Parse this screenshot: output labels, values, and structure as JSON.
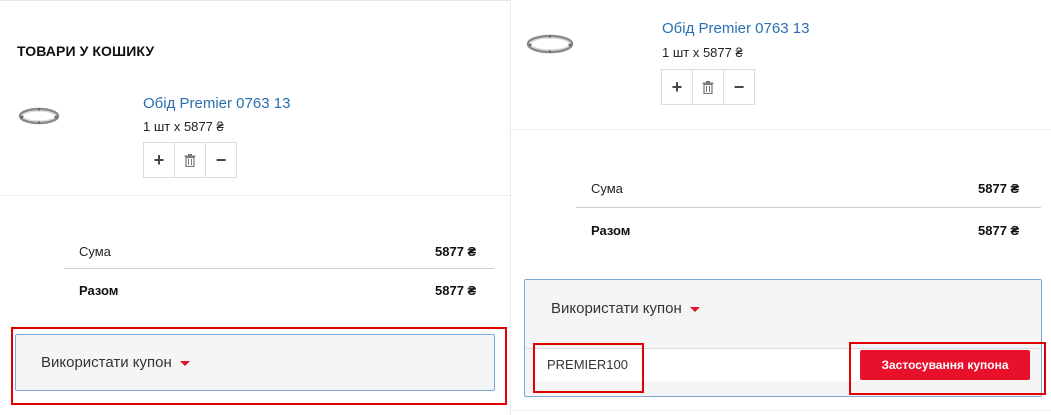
{
  "left": {
    "title": "ТОВАРИ У КОШИКУ",
    "product": {
      "name": "Обід Premier 0763 13",
      "qty_text": "1 шт x 5877 ₴"
    },
    "summary": {
      "sum_label": "Сума",
      "sum_value": "5877 ₴",
      "total_label": "Разом",
      "total_value": "5877 ₴"
    },
    "coupon": {
      "label": "Використати купон"
    }
  },
  "right": {
    "product": {
      "name": "Обід Premier 0763 13",
      "qty_text": "1 шт x 5877 ₴"
    },
    "summary": {
      "sum_label": "Сума",
      "sum_value": "5877 ₴",
      "total_label": "Разом",
      "total_value": "5877 ₴"
    },
    "coupon": {
      "label": "Використати купон",
      "input_value": "PREMIER100",
      "apply_label": "Застосування купона"
    }
  },
  "stepper": {
    "plus": "+",
    "delete_icon": "trash-icon",
    "minus": "−"
  },
  "colors": {
    "accent": "#e8102b",
    "link": "#2a6fb0",
    "highlight": "#e00000"
  }
}
